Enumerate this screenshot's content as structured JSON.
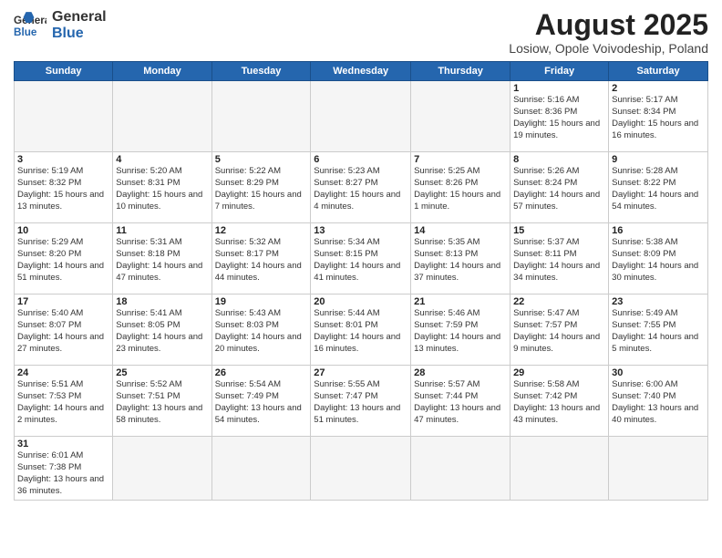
{
  "header": {
    "logo_general": "General",
    "logo_blue": "Blue",
    "month": "August 2025",
    "location": "Losiow, Opole Voivodeship, Poland"
  },
  "days_of_week": [
    "Sunday",
    "Monday",
    "Tuesday",
    "Wednesday",
    "Thursday",
    "Friday",
    "Saturday"
  ],
  "weeks": [
    [
      {
        "day": "",
        "info": ""
      },
      {
        "day": "",
        "info": ""
      },
      {
        "day": "",
        "info": ""
      },
      {
        "day": "",
        "info": ""
      },
      {
        "day": "",
        "info": ""
      },
      {
        "day": "1",
        "info": "Sunrise: 5:16 AM\nSunset: 8:36 PM\nDaylight: 15 hours and 19 minutes."
      },
      {
        "day": "2",
        "info": "Sunrise: 5:17 AM\nSunset: 8:34 PM\nDaylight: 15 hours and 16 minutes."
      }
    ],
    [
      {
        "day": "3",
        "info": "Sunrise: 5:19 AM\nSunset: 8:32 PM\nDaylight: 15 hours and 13 minutes."
      },
      {
        "day": "4",
        "info": "Sunrise: 5:20 AM\nSunset: 8:31 PM\nDaylight: 15 hours and 10 minutes."
      },
      {
        "day": "5",
        "info": "Sunrise: 5:22 AM\nSunset: 8:29 PM\nDaylight: 15 hours and 7 minutes."
      },
      {
        "day": "6",
        "info": "Sunrise: 5:23 AM\nSunset: 8:27 PM\nDaylight: 15 hours and 4 minutes."
      },
      {
        "day": "7",
        "info": "Sunrise: 5:25 AM\nSunset: 8:26 PM\nDaylight: 15 hours and 1 minute."
      },
      {
        "day": "8",
        "info": "Sunrise: 5:26 AM\nSunset: 8:24 PM\nDaylight: 14 hours and 57 minutes."
      },
      {
        "day": "9",
        "info": "Sunrise: 5:28 AM\nSunset: 8:22 PM\nDaylight: 14 hours and 54 minutes."
      }
    ],
    [
      {
        "day": "10",
        "info": "Sunrise: 5:29 AM\nSunset: 8:20 PM\nDaylight: 14 hours and 51 minutes."
      },
      {
        "day": "11",
        "info": "Sunrise: 5:31 AM\nSunset: 8:18 PM\nDaylight: 14 hours and 47 minutes."
      },
      {
        "day": "12",
        "info": "Sunrise: 5:32 AM\nSunset: 8:17 PM\nDaylight: 14 hours and 44 minutes."
      },
      {
        "day": "13",
        "info": "Sunrise: 5:34 AM\nSunset: 8:15 PM\nDaylight: 14 hours and 41 minutes."
      },
      {
        "day": "14",
        "info": "Sunrise: 5:35 AM\nSunset: 8:13 PM\nDaylight: 14 hours and 37 minutes."
      },
      {
        "day": "15",
        "info": "Sunrise: 5:37 AM\nSunset: 8:11 PM\nDaylight: 14 hours and 34 minutes."
      },
      {
        "day": "16",
        "info": "Sunrise: 5:38 AM\nSunset: 8:09 PM\nDaylight: 14 hours and 30 minutes."
      }
    ],
    [
      {
        "day": "17",
        "info": "Sunrise: 5:40 AM\nSunset: 8:07 PM\nDaylight: 14 hours and 27 minutes."
      },
      {
        "day": "18",
        "info": "Sunrise: 5:41 AM\nSunset: 8:05 PM\nDaylight: 14 hours and 23 minutes."
      },
      {
        "day": "19",
        "info": "Sunrise: 5:43 AM\nSunset: 8:03 PM\nDaylight: 14 hours and 20 minutes."
      },
      {
        "day": "20",
        "info": "Sunrise: 5:44 AM\nSunset: 8:01 PM\nDaylight: 14 hours and 16 minutes."
      },
      {
        "day": "21",
        "info": "Sunrise: 5:46 AM\nSunset: 7:59 PM\nDaylight: 14 hours and 13 minutes."
      },
      {
        "day": "22",
        "info": "Sunrise: 5:47 AM\nSunset: 7:57 PM\nDaylight: 14 hours and 9 minutes."
      },
      {
        "day": "23",
        "info": "Sunrise: 5:49 AM\nSunset: 7:55 PM\nDaylight: 14 hours and 5 minutes."
      }
    ],
    [
      {
        "day": "24",
        "info": "Sunrise: 5:51 AM\nSunset: 7:53 PM\nDaylight: 14 hours and 2 minutes."
      },
      {
        "day": "25",
        "info": "Sunrise: 5:52 AM\nSunset: 7:51 PM\nDaylight: 13 hours and 58 minutes."
      },
      {
        "day": "26",
        "info": "Sunrise: 5:54 AM\nSunset: 7:49 PM\nDaylight: 13 hours and 54 minutes."
      },
      {
        "day": "27",
        "info": "Sunrise: 5:55 AM\nSunset: 7:47 PM\nDaylight: 13 hours and 51 minutes."
      },
      {
        "day": "28",
        "info": "Sunrise: 5:57 AM\nSunset: 7:44 PM\nDaylight: 13 hours and 47 minutes."
      },
      {
        "day": "29",
        "info": "Sunrise: 5:58 AM\nSunset: 7:42 PM\nDaylight: 13 hours and 43 minutes."
      },
      {
        "day": "30",
        "info": "Sunrise: 6:00 AM\nSunset: 7:40 PM\nDaylight: 13 hours and 40 minutes."
      }
    ],
    [
      {
        "day": "31",
        "info": "Sunrise: 6:01 AM\nSunset: 7:38 PM\nDaylight: 13 hours and 36 minutes."
      },
      {
        "day": "",
        "info": ""
      },
      {
        "day": "",
        "info": ""
      },
      {
        "day": "",
        "info": ""
      },
      {
        "day": "",
        "info": ""
      },
      {
        "day": "",
        "info": ""
      },
      {
        "day": "",
        "info": ""
      }
    ]
  ]
}
